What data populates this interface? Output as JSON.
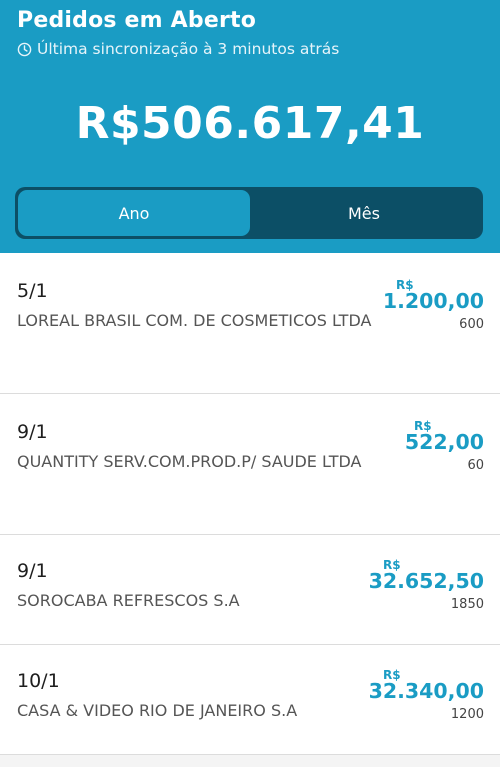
{
  "header": {
    "title": "Pedidos em Aberto",
    "sync_text": "Última sincronização à 3 minutos atrás",
    "total": "R$506.617,41",
    "tabs": [
      {
        "label": "Ano",
        "active": true
      },
      {
        "label": "Mês",
        "active": false
      }
    ]
  },
  "colors": {
    "accent": "#1a9cc4",
    "segment_bg": "#0c4f66"
  },
  "orders": [
    {
      "date": "5/1",
      "customer": "LOREAL BRASIL COM. DE COSMETICOS LTDA",
      "currency": "R$",
      "amount": "1.200,00",
      "quantity": "600"
    },
    {
      "date": "9/1",
      "customer": "QUANTITY SERV.COM.PROD.P/ SAUDE LTDA",
      "currency": "R$",
      "amount": "522,00",
      "quantity": "60"
    },
    {
      "date": "9/1",
      "customer": "SOROCABA REFRESCOS S.A",
      "currency": "R$",
      "amount": "32.652,50",
      "quantity": "1850"
    },
    {
      "date": "10/1",
      "customer": "CASA & VIDEO RIO DE JANEIRO S.A",
      "currency": "R$",
      "amount": "32.340,00",
      "quantity": "1200"
    }
  ]
}
